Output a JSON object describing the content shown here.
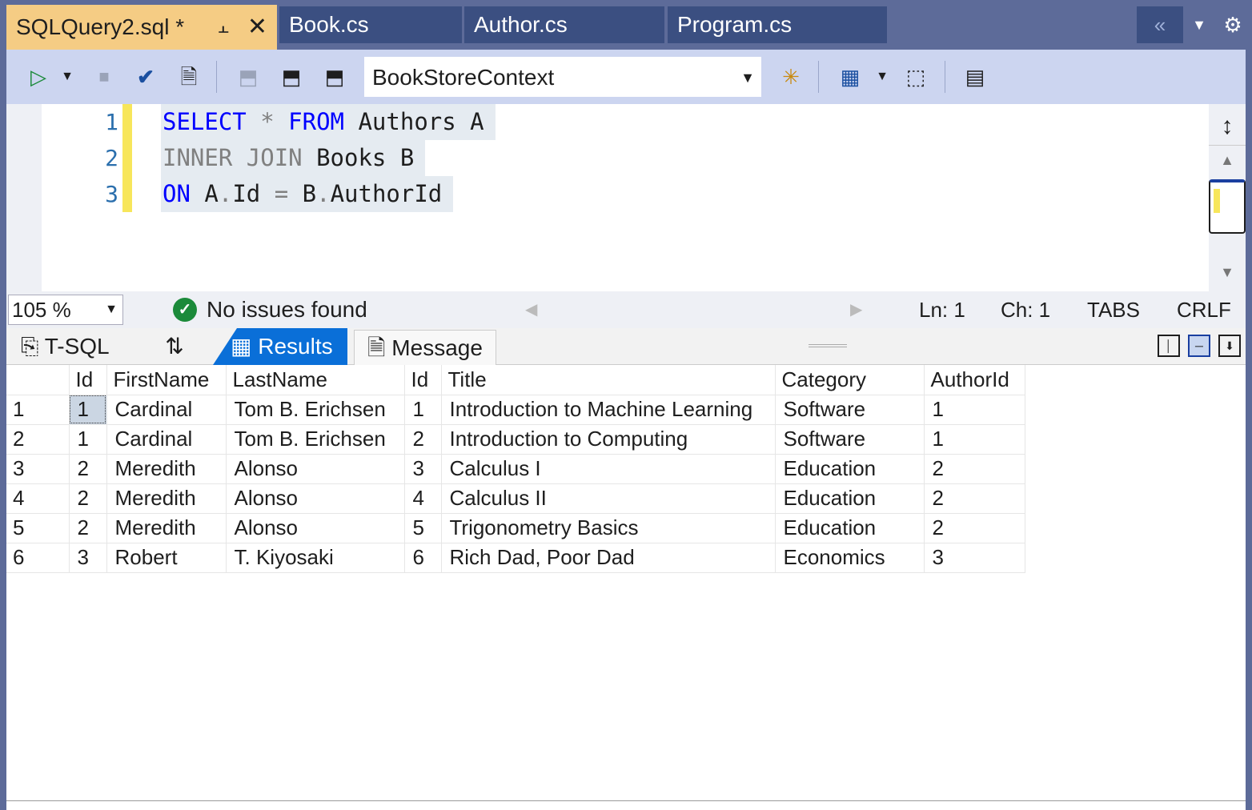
{
  "tabs": [
    {
      "label": "SQLQuery2.sql *",
      "active": true
    },
    {
      "label": "Book.cs"
    },
    {
      "label": "Author.cs"
    },
    {
      "label": "Program.cs"
    }
  ],
  "icons": {
    "pin": "pin-icon",
    "close": "close-icon",
    "overflow": "double-chevron-left-icon",
    "menu": "chevron-down-icon",
    "settings": "gear-icon"
  },
  "toolbar": {
    "connection": "BookStoreContext"
  },
  "editor": {
    "lines": [
      {
        "num": "1",
        "tokens": [
          [
            "kw",
            "SELECT"
          ],
          [
            "tx",
            " "
          ],
          [
            "kg",
            "*"
          ],
          [
            "tx",
            " "
          ],
          [
            "kw",
            "FROM"
          ],
          [
            "tx",
            " Authors A"
          ]
        ]
      },
      {
        "num": "2",
        "tokens": [
          [
            "kg",
            "INNER"
          ],
          [
            "tx",
            " "
          ],
          [
            "kg",
            "JOIN"
          ],
          [
            "tx",
            " Books B"
          ]
        ]
      },
      {
        "num": "3",
        "tokens": [
          [
            "kw",
            "ON"
          ],
          [
            "tx",
            " A"
          ],
          [
            "kg",
            "."
          ],
          [
            "tx",
            "Id "
          ],
          [
            "kg",
            "="
          ],
          [
            "tx",
            " B"
          ],
          [
            "kg",
            "."
          ],
          [
            "tx",
            "AuthorId"
          ]
        ]
      }
    ]
  },
  "status": {
    "zoom": "105 %",
    "issues": "No issues found",
    "ln": "Ln: 1",
    "ch": "Ch: 1",
    "tabs": "TABS",
    "eol": "CRLF"
  },
  "results_tabs": {
    "tsql": "T-SQL",
    "results": "Results",
    "message": "Message"
  },
  "grid": {
    "columns": [
      "",
      "Id",
      "FirstName",
      "LastName",
      "Id",
      "Title",
      "Category",
      "AuthorId"
    ],
    "rows": [
      [
        "1",
        "1",
        "Cardinal",
        "Tom B. Erichsen",
        "1",
        "Introduction to Machine Learning",
        "Software",
        "1"
      ],
      [
        "2",
        "1",
        "Cardinal",
        "Tom B. Erichsen",
        "2",
        "Introduction to Computing",
        "Software",
        "1"
      ],
      [
        "3",
        "2",
        "Meredith",
        "Alonso",
        "3",
        "Calculus I",
        "Education",
        "2"
      ],
      [
        "4",
        "2",
        "Meredith",
        "Alonso",
        "4",
        "Calculus II",
        "Education",
        "2"
      ],
      [
        "5",
        "2",
        "Meredith",
        "Alonso",
        "5",
        "Trigonometry Basics",
        "Education",
        "2"
      ],
      [
        "6",
        "3",
        "Robert",
        "T. Kiyosaki",
        "6",
        "Rich Dad, Poor Dad",
        "Economics",
        "3"
      ]
    ]
  }
}
